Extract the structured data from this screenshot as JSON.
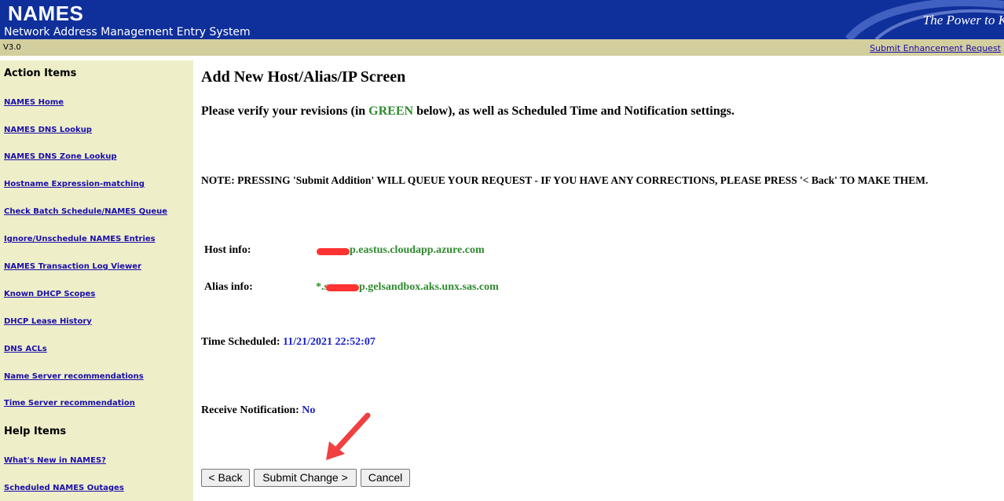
{
  "header": {
    "title": "NAMES",
    "subtitle": "Network Address Management Entry System",
    "tagline": "The Power to K"
  },
  "version_bar": {
    "version": "V3.0",
    "enhancement_link": "Submit Enhancement Request"
  },
  "sidebar": {
    "action_heading": "Action Items",
    "action_items": [
      "NAMES Home",
      "NAMES DNS Lookup",
      "NAMES DNS Zone Lookup",
      "Hostname Expression-matching",
      "Check Batch Schedule/NAMES Queue",
      "Ignore/Unschedule NAMES Entries",
      "NAMES Transaction Log Viewer",
      "Known DHCP Scopes",
      "DHCP Lease History",
      "DNS ACLs",
      "Name Server recommendations",
      "Time Server recommendation"
    ],
    "help_heading": "Help Items",
    "help_items": [
      "What's New in NAMES?",
      "Scheduled NAMES Outages"
    ]
  },
  "main": {
    "page_title": "Add New Host/Alias/IP Screen",
    "verify_prefix": "Please verify your revisions (in ",
    "verify_green": "GREEN",
    "verify_suffix": " below), as well as Scheduled Time and Notification settings.",
    "note": "NOTE: PRESSING 'Submit Addition' WILL QUEUE YOUR REQUEST - IF YOU HAVE ANY CORRECTIONS, PLEASE PRESS '< Back' TO MAKE THEM.",
    "host_label": "Host info:",
    "host_value": "p.eastus.cloudapp.azure.com",
    "alias_label": "Alias info:",
    "alias_prefix": "*.s",
    "alias_value": "p.gelsandbox.aks.unx.sas.com",
    "time_label": "Time Scheduled:",
    "time_value": "11/21/2021 22:52:07",
    "notify_label": "Receive Notification:",
    "notify_value": "No"
  },
  "buttons": {
    "back": "< Back",
    "submit": "Submit Change >",
    "cancel": "Cancel"
  },
  "colors": {
    "header_bg": "#0f2f9a",
    "version_bar_bg": "#d3ce9e",
    "sidebar_bg": "#eeeec9",
    "link": "#1a0dab",
    "green": "#2f8a2f",
    "blue_value": "#1a22c8",
    "redaction": "#ff3333",
    "annotation_arrow": "#f04040"
  }
}
